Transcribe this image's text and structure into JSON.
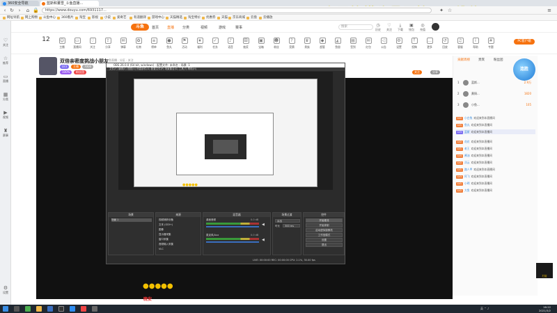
{
  "browser": {
    "tabs": [
      {
        "label": "360安全导航",
        "active": false
      },
      {
        "label": "蓝斯和董雪_斗鱼直播...",
        "active": true
      }
    ],
    "url": "https://www.douyu.com/6931117...",
    "watermark": "上网搞懂头是网管 ... 维修",
    "bookmarks": [
      "网址导航",
      "网上购物",
      "斗鱼中心",
      "360看片",
      "淘宝",
      "影视",
      "小说",
      "爱奇艺",
      "有道翻译",
      "游戏中心",
      "天猫精选",
      "淘宝特价",
      "优惠券",
      "天猫",
      "京东商城",
      "云盘",
      "云播放"
    ]
  },
  "rail": [
    "关注",
    "推荐",
    "直播",
    "分类",
    "视频",
    "赛事",
    "设置"
  ],
  "site": {
    "logo": "斗鱼",
    "nav": [
      "首页",
      "直播",
      "分类",
      "视频",
      "游戏",
      "赛事"
    ],
    "search_placeholder": "搜索",
    "header_icons": [
      "历史",
      "关注",
      "下载",
      "钱包",
      "充值"
    ]
  },
  "toolbar": {
    "count": "12",
    "items": [
      "主播",
      "直播间",
      "关注",
      "分享",
      "弹幕",
      "礼物",
      "榜单",
      "鱼丸",
      "活动",
      "福利",
      "任务",
      "语音",
      "抽奖",
      "宝箱",
      "粉丝",
      "竞猜",
      "贵族",
      "超管",
      "鱼翅",
      "签到",
      "红包",
      "公告",
      "设置",
      "投稿",
      "更多",
      "回放",
      "客服",
      "帮助",
      "专题"
    ],
    "pc_button": "PC客户端"
  },
  "streamer": {
    "title": "双倍亲密度挑战小朋友",
    "subtitle": "斗鱼直播 · 分区 · 关注",
    "chips": [
      "LV3",
      "主播",
      "7000",
      "100%",
      "粉丝团"
    ],
    "follow": "关注",
    "share": "分享"
  },
  "obs": {
    "title_bar": "OBS 26.0.0 (64 bit, windows) - 配置文件: 未命名 - 场景: 1",
    "menu": "文件(F)  编辑(E)  视图(V)  停靠部件(D)  配置文件(P)  场景集合(S)  工具(T)  帮助(H)",
    "docks": {
      "scenes": "场景",
      "sources": "来源",
      "mixer": "混音器",
      "transitions": "场景过渡",
      "controls": "控件"
    },
    "scene_item": "场景 1",
    "sources": [
      "视频捕获设备",
      "文本 (GDI+)",
      "图像",
      "显示器采集",
      "窗口采集",
      "音频输入采集",
      "VLC"
    ],
    "mixer": [
      "桌面音频",
      "麦克风/Aux"
    ],
    "mixer_db": [
      "0.0 dB",
      "0.0 dB"
    ],
    "transition": "淡出",
    "duration_label": "时长",
    "duration": "300 ms",
    "controls": [
      "开始推流",
      "开始录制",
      "启动虚拟摄像机",
      "工作室模式",
      "设置",
      "退出"
    ],
    "status": "LIVE: 00:00:00   REC: 00:00:00   CPU: 2.1%, 30.00 fps"
  },
  "overlay": {
    "emoji_row": "●●●●●",
    "emoji_small": "●●●●●",
    "caption": "晚安"
  },
  "right": {
    "tabs": [
      "贡献周榜",
      "贵宾",
      "粉丝团"
    ],
    "ranks": [
      {
        "n": "1",
        "name": "蓝斯...",
        "score": "2.9万"
      },
      {
        "n": "2",
        "name": "黄铜...",
        "score": "1820"
      },
      {
        "n": "3",
        "name": "小鱼...",
        "score": "105"
      }
    ],
    "chat": [
      {
        "badge": "LV2",
        "user": "小白兔",
        "text": "欢迎来到本直播间"
      },
      {
        "badge": "LV1",
        "user": "鱼丸",
        "text": "欢迎来到本直播间"
      },
      {
        "badge": "LV3",
        "user": "蓝斯",
        "text": "欢迎来到本直播间"
      },
      {
        "badge": "LV2",
        "user": "花花",
        "text": "欢迎来到本直播间"
      },
      {
        "badge": "LV1",
        "user": "老王",
        "text": "欢迎来到本直播间"
      },
      {
        "badge": "LV4",
        "user": "酱油",
        "text": "欢迎来到本直播间"
      },
      {
        "badge": "LV2",
        "user": "浮云",
        "text": "欢迎来到本直播间"
      },
      {
        "badge": "LV1",
        "user": "路人甲",
        "text": "欢迎来到本直播间"
      },
      {
        "badge": "LV3",
        "user": "阿飞",
        "text": "欢迎来到本直播间"
      },
      {
        "badge": "LV1",
        "user": "小明",
        "text": "欢迎来到本直播间"
      },
      {
        "badge": "LV2",
        "user": "大鱼",
        "text": "欢迎来到本直播间"
      }
    ],
    "promo": "连胜",
    "corner": "打赏"
  },
  "taskbar": {
    "time": "16:22",
    "date": "2021/3/2",
    "tray": "英 ⌃ ♪"
  }
}
